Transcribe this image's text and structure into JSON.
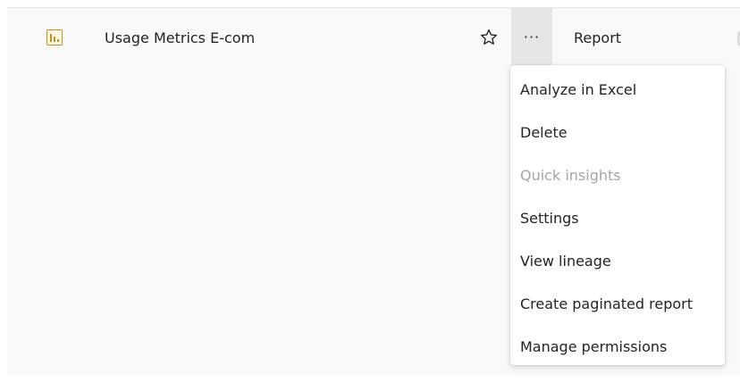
{
  "row": {
    "icon": "report-bar-chart-icon",
    "name": "Usage Metrics E-com",
    "favorite_icon": "star-outline-icon",
    "more_label": "···",
    "type": "Report"
  },
  "colors": {
    "report_icon": "#c88f1b",
    "text": "#252423",
    "disabled_text": "#a6a6a6",
    "row_background": "#f9f9f9",
    "more_button_background": "#e6e6e6"
  },
  "menu": {
    "items": [
      {
        "label": "Analyze in Excel",
        "enabled": true
      },
      {
        "label": "Delete",
        "enabled": true
      },
      {
        "label": "Quick insights",
        "enabled": false
      },
      {
        "label": "Settings",
        "enabled": true
      },
      {
        "label": "View lineage",
        "enabled": true
      },
      {
        "label": "Create paginated report",
        "enabled": true
      },
      {
        "label": "Manage permissions",
        "enabled": true
      }
    ]
  }
}
